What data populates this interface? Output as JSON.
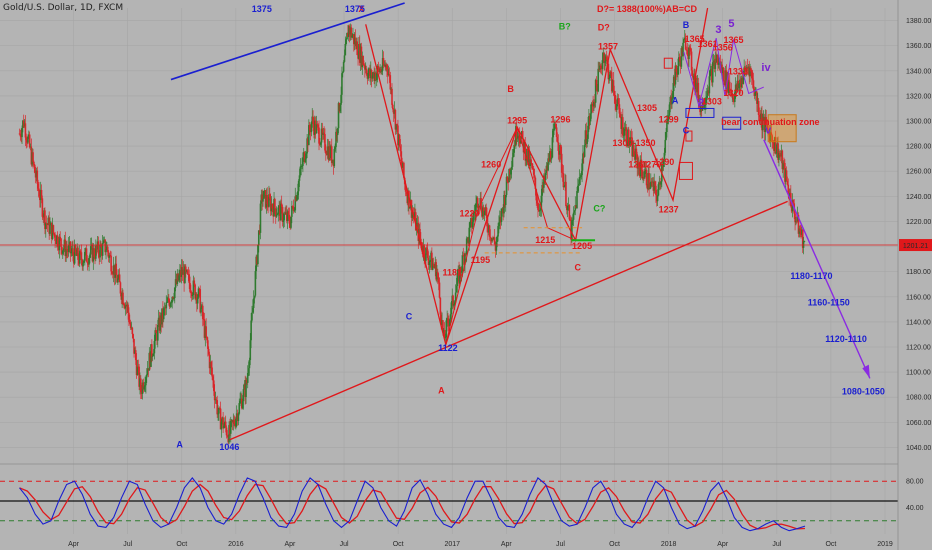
{
  "header": {
    "symbol": "Gold/U.S. Dollar, 1D, FXCM"
  },
  "colors": {
    "background": "#b4b4b4",
    "grid": "#a6a6a6",
    "candle_up": "#2f7a2f",
    "candle_down": "#d8262a",
    "trend_red": "#e0181b",
    "trend_blue": "#1a1fd0",
    "projection": "#8a2be2",
    "stoch_k": "#1a1fd0",
    "stoch_d": "#e0181b"
  },
  "chart_data": [
    {
      "type": "candlestick",
      "title": "",
      "ylim": [
        1030,
        1390
      ],
      "y_ticks": [
        "1380.00",
        "1360.00",
        "1340.00",
        "1320.00",
        "1300.00",
        "1280.00",
        "1260.00",
        "1240.00",
        "1220.00",
        "1200.00",
        "1180.00",
        "1160.00",
        "1140.00",
        "1120.00",
        "1100.00",
        "1080.00",
        "1060.00",
        "1040.00"
      ],
      "x_ticks": [
        "Apr",
        "Jul",
        "Oct",
        "2016",
        "Apr",
        "Jul",
        "Oct",
        "2017",
        "Apr",
        "Jul",
        "Oct",
        "2018",
        "Apr",
        "Jul",
        "Oct",
        "2019"
      ],
      "current_price": "1201.21",
      "price_path": [
        {
          "t": 2015.0,
          "p": 1290
        },
        {
          "t": 2015.02,
          "p": 1300
        },
        {
          "t": 2015.12,
          "p": 1220
        },
        {
          "t": 2015.2,
          "p": 1200
        },
        {
          "t": 2015.28,
          "p": 1190
        },
        {
          "t": 2015.4,
          "p": 1200
        },
        {
          "t": 2015.5,
          "p": 1150
        },
        {
          "t": 2015.56,
          "p": 1085
        },
        {
          "t": 2015.65,
          "p": 1140
        },
        {
          "t": 2015.75,
          "p": 1180
        },
        {
          "t": 2015.83,
          "p": 1160
        },
        {
          "t": 2015.92,
          "p": 1065
        },
        {
          "t": 2015.97,
          "p": 1050
        },
        {
          "t": 2016.05,
          "p": 1090
        },
        {
          "t": 2016.12,
          "p": 1240
        },
        {
          "t": 2016.25,
          "p": 1220
        },
        {
          "t": 2016.35,
          "p": 1300
        },
        {
          "t": 2016.45,
          "p": 1270
        },
        {
          "t": 2016.52,
          "p": 1375
        },
        {
          "t": 2016.62,
          "p": 1335
        },
        {
          "t": 2016.7,
          "p": 1345
        },
        {
          "t": 2016.78,
          "p": 1250
        },
        {
          "t": 2016.86,
          "p": 1200
        },
        {
          "t": 2016.93,
          "p": 1180
        },
        {
          "t": 2016.96,
          "p": 1125
        },
        {
          "t": 2017.05,
          "p": 1190
        },
        {
          "t": 2017.12,
          "p": 1240
        },
        {
          "t": 2017.2,
          "p": 1200
        },
        {
          "t": 2017.3,
          "p": 1295
        },
        {
          "t": 2017.37,
          "p": 1260
        },
        {
          "t": 2017.4,
          "p": 1230
        },
        {
          "t": 2017.48,
          "p": 1296
        },
        {
          "t": 2017.55,
          "p": 1210
        },
        {
          "t": 2017.62,
          "p": 1290
        },
        {
          "t": 2017.7,
          "p": 1355
        },
        {
          "t": 2017.78,
          "p": 1300
        },
        {
          "t": 2017.86,
          "p": 1265
        },
        {
          "t": 2017.95,
          "p": 1240
        },
        {
          "t": 2018.02,
          "p": 1330
        },
        {
          "t": 2018.08,
          "p": 1365
        },
        {
          "t": 2018.15,
          "p": 1310
        },
        {
          "t": 2018.22,
          "p": 1350
        },
        {
          "t": 2018.3,
          "p": 1320
        },
        {
          "t": 2018.37,
          "p": 1345
        },
        {
          "t": 2018.43,
          "p": 1300
        },
        {
          "t": 2018.47,
          "p": 1290
        },
        {
          "t": 2018.52,
          "p": 1270
        },
        {
          "t": 2018.56,
          "p": 1240
        },
        {
          "t": 2018.6,
          "p": 1215
        },
        {
          "t": 2018.63,
          "p": 1201
        }
      ],
      "annotations_red": [
        {
          "t": 2016.58,
          "p": 1387,
          "text": "X"
        },
        {
          "t": 2017.27,
          "p": 1323,
          "text": "B"
        },
        {
          "t": 2017.3,
          "p": 1298,
          "text": "1295"
        },
        {
          "t": 2017.5,
          "p": 1299,
          "text": "1296"
        },
        {
          "t": 2017.18,
          "p": 1263,
          "text": "1260"
        },
        {
          "t": 2017.08,
          "p": 1224,
          "text": "1220"
        },
        {
          "t": 2017.43,
          "p": 1203,
          "text": "1215"
        },
        {
          "t": 2017.13,
          "p": 1187,
          "text": "1195"
        },
        {
          "t": 2017.0,
          "p": 1177,
          "text": "1181"
        },
        {
          "t": 2017.6,
          "p": 1198,
          "text": "1205"
        },
        {
          "t": 2017.58,
          "p": 1181,
          "text": "C"
        },
        {
          "t": 2016.95,
          "p": 1083,
          "text": "A"
        },
        {
          "t": 2017.7,
          "p": 1372,
          "text": "D?"
        },
        {
          "t": 2017.72,
          "p": 1357,
          "text": "1357"
        },
        {
          "t": 2017.9,
          "p": 1308,
          "text": "1305"
        },
        {
          "t": 2018.0,
          "p": 1299,
          "text": "1299"
        },
        {
          "t": 2017.84,
          "p": 1280,
          "text": "1300-1350"
        },
        {
          "t": 2017.86,
          "p": 1263,
          "text": "1261"
        },
        {
          "t": 2017.92,
          "p": 1263,
          "text": "1270"
        },
        {
          "t": 2017.98,
          "p": 1265,
          "text": "1290"
        },
        {
          "t": 2018.0,
          "p": 1227,
          "text": "1237"
        },
        {
          "t": 2018.12,
          "p": 1363,
          "text": "1365"
        },
        {
          "t": 2018.18,
          "p": 1359,
          "text": "1361"
        },
        {
          "t": 2018.25,
          "p": 1356,
          "text": "1356"
        },
        {
          "t": 2018.3,
          "p": 1362,
          "text": "1365"
        },
        {
          "t": 2018.32,
          "p": 1337,
          "text": "1333"
        },
        {
          "t": 2018.3,
          "p": 1320,
          "text": "1320"
        },
        {
          "t": 2018.2,
          "p": 1313,
          "text": "1303"
        },
        {
          "t": 2018.47,
          "p": 1297,
          "text": "bear continuation zone"
        },
        {
          "t": 2017.9,
          "p": 1387,
          "text": "D?= 1388(100%)AB=CD"
        }
      ],
      "annotations_blue": [
        {
          "t": 2016.12,
          "p": 1387,
          "text": "1375"
        },
        {
          "t": 2016.55,
          "p": 1387,
          "text": "1375"
        },
        {
          "t": 2016.8,
          "p": 1142,
          "text": "C"
        },
        {
          "t": 2016.98,
          "p": 1117,
          "text": "1122"
        },
        {
          "t": 2015.74,
          "p": 1040,
          "text": "A"
        },
        {
          "t": 2015.97,
          "p": 1038,
          "text": "1046"
        },
        {
          "t": 2018.08,
          "p": 1374,
          "text": "B"
        },
        {
          "t": 2018.08,
          "p": 1290,
          "text": "C"
        },
        {
          "t": 2018.03,
          "p": 1314,
          "text": "A"
        },
        {
          "t": 2018.66,
          "p": 1174,
          "text": "1180-1170"
        },
        {
          "t": 2018.74,
          "p": 1153,
          "text": "1160-1150"
        },
        {
          "t": 2018.82,
          "p": 1124,
          "text": "1120-1110"
        },
        {
          "t": 2018.9,
          "p": 1082,
          "text": "1080-1050"
        }
      ],
      "annotations_purple": [
        {
          "t": 2018.23,
          "p": 1370,
          "text": "3"
        },
        {
          "t": 2018.29,
          "p": 1375,
          "text": "5"
        },
        {
          "t": 2018.15,
          "p": 1312,
          "text": "2"
        },
        {
          "t": 2018.45,
          "p": 1340,
          "text": "iv"
        },
        {
          "t": 2018.46,
          "p": 1290,
          "text": "v"
        }
      ],
      "annotations_green": [
        {
          "t": 2017.52,
          "p": 1373,
          "text": "B?"
        },
        {
          "t": 2017.68,
          "p": 1228,
          "text": "C?"
        }
      ]
    },
    {
      "type": "line",
      "title": "",
      "ylim": [
        0,
        100
      ],
      "y_ticks": [
        "80.00",
        "40.00"
      ],
      "series": [
        {
          "values": [
            70,
            55,
            30,
            15,
            20,
            50,
            75,
            80,
            60,
            30,
            12,
            10,
            25,
            55,
            80,
            75,
            45,
            20,
            10,
            15,
            40,
            70,
            85,
            70,
            40,
            20,
            15,
            30,
            60,
            85,
            80,
            55,
            25,
            12,
            10,
            30,
            65,
            85,
            75,
            45,
            20,
            10,
            20,
            50,
            80,
            70,
            40,
            20,
            12,
            35,
            70,
            82,
            60,
            30,
            15,
            10,
            25,
            55,
            80,
            80,
            55,
            25,
            12,
            10,
            30,
            60,
            85,
            75,
            45,
            20,
            12,
            15,
            40,
            70,
            80,
            60,
            30,
            15,
            10,
            25,
            55,
            80,
            70,
            40,
            15,
            8,
            12,
            35,
            65,
            78,
            55,
            25,
            10,
            5,
            8,
            15,
            20,
            10,
            5,
            8,
            12
          ]
        }
      ]
    }
  ]
}
